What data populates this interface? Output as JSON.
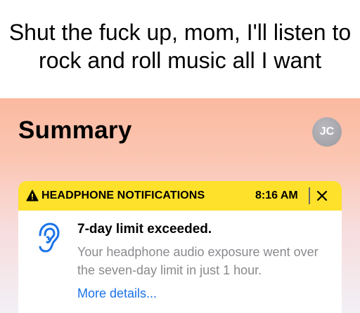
{
  "caption": {
    "text": "Shut the fuck up, mom, I'll listen to rock and roll music all I want"
  },
  "summary": {
    "title": "Summary",
    "avatar_initials": "JC"
  },
  "notification": {
    "header_label": "HEADPHONE NOTIFICATIONS",
    "time": "8:16 AM",
    "title": "7-day limit exceeded.",
    "body": "Your headphone audio exposure went over the seven-day limit in just 1 hour.",
    "link": "More details...",
    "icons": {
      "header": "warning-triangle-icon",
      "close": "close-icon",
      "app": "ear-icon"
    },
    "colors": {
      "header_bg": "#fde12a",
      "link": "#1a73e8",
      "ear": "#1a73e8"
    }
  }
}
